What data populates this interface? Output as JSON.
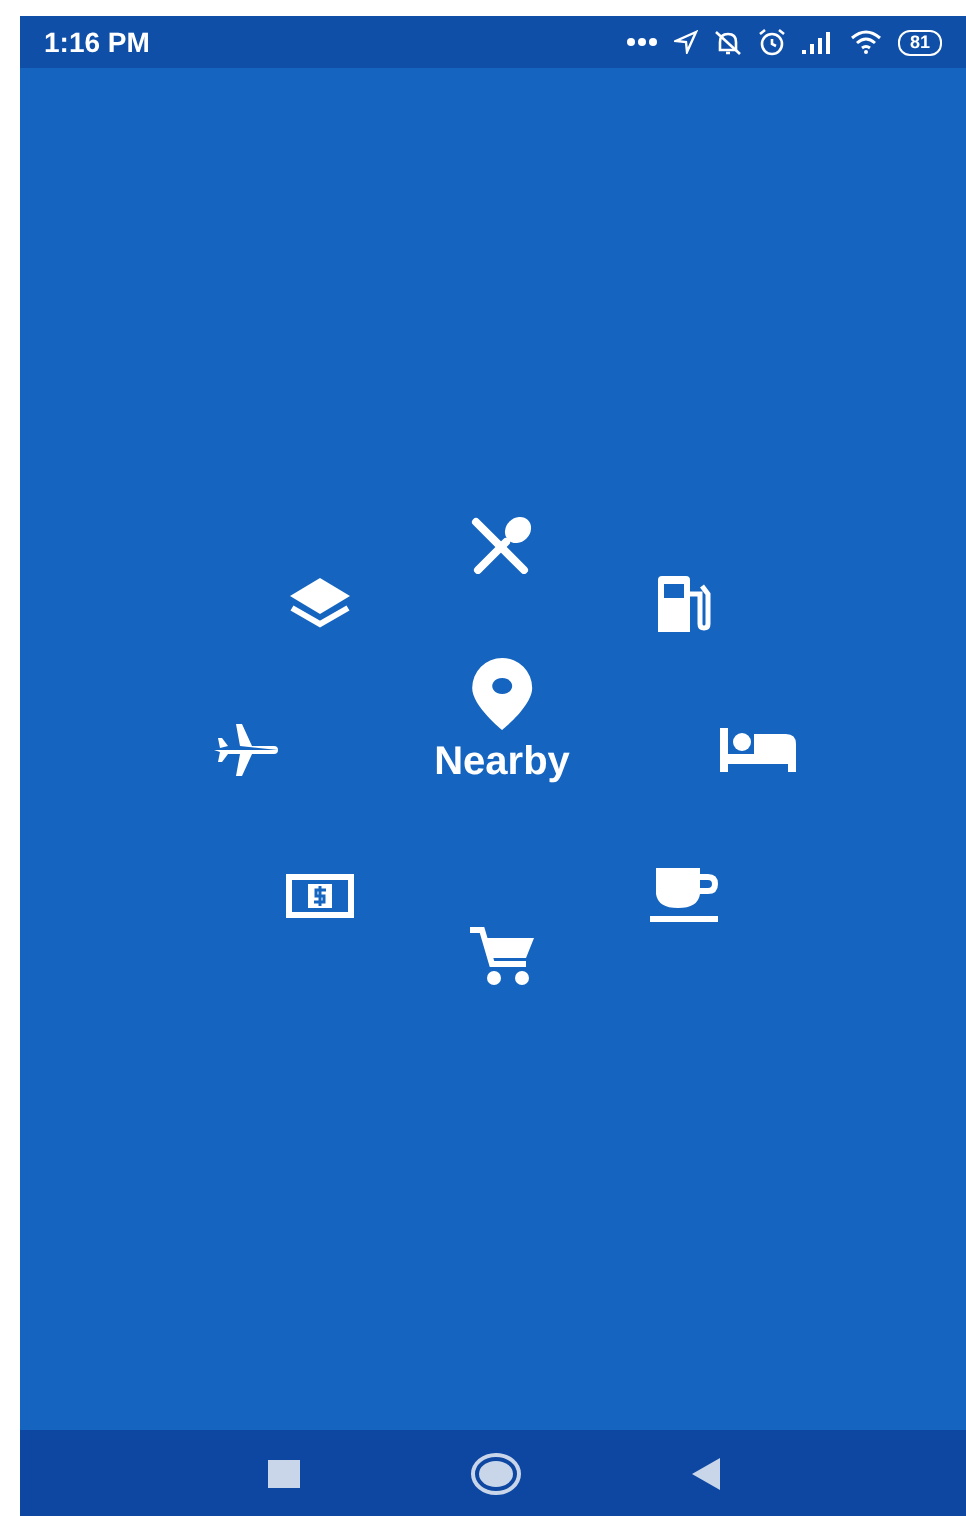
{
  "status_bar": {
    "time": "1:16 PM",
    "battery": "81"
  },
  "center": {
    "label": "Nearby"
  },
  "categories": [
    {
      "kind": "restaurant"
    },
    {
      "kind": "gas"
    },
    {
      "kind": "hotel"
    },
    {
      "kind": "cafe"
    },
    {
      "kind": "shopping"
    },
    {
      "kind": "atm"
    },
    {
      "kind": "airport"
    },
    {
      "kind": "layers"
    }
  ]
}
